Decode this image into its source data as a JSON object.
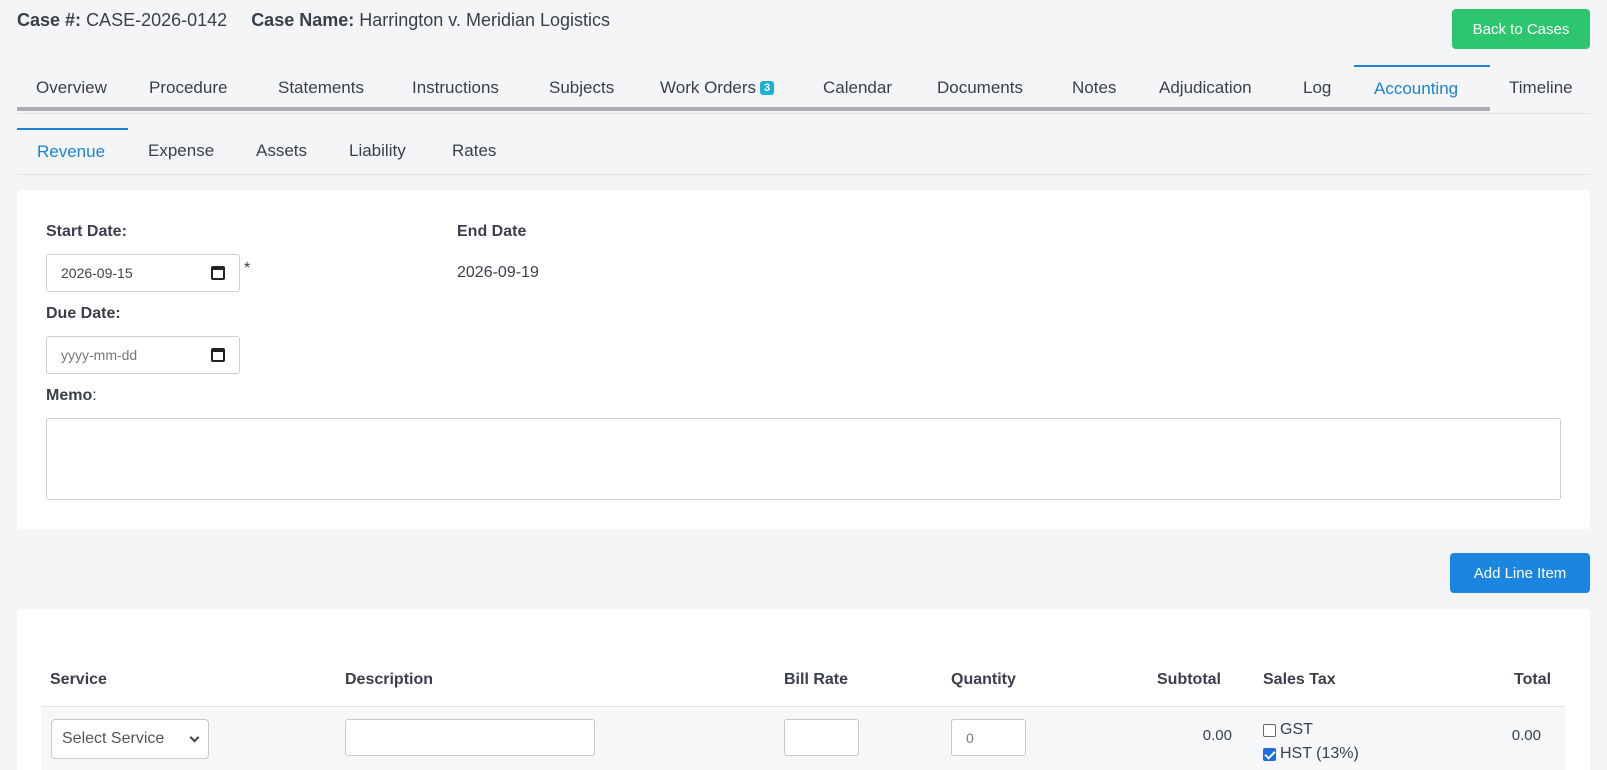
{
  "header": {
    "case_no_label": "Case #:",
    "case_no": "CASE-2026-0142",
    "case_name_label": "Case Name:",
    "case_name": "Harrington v. Meridian Logistics",
    "back_button": "Back to Cases"
  },
  "tabs": [
    {
      "label": "Overview"
    },
    {
      "label": "Procedure"
    },
    {
      "label": "Statements"
    },
    {
      "label": "Instructions"
    },
    {
      "label": "Subjects"
    },
    {
      "label": "Work Orders",
      "badge": "3"
    },
    {
      "label": "Calendar"
    },
    {
      "label": "Documents"
    },
    {
      "label": "Notes"
    },
    {
      "label": "Adjudication"
    },
    {
      "label": "Log"
    },
    {
      "label": "Accounting",
      "active": true
    },
    {
      "label": "Timeline"
    }
  ],
  "subtabs": [
    {
      "label": "Revenue",
      "active": true
    },
    {
      "label": "Expense"
    },
    {
      "label": "Assets"
    },
    {
      "label": "Liability"
    },
    {
      "label": "Rates"
    }
  ],
  "form": {
    "start_date_label": "Start Date:",
    "start_date_value": "2026-09-15",
    "required_mark": "*",
    "end_date_label": "End Date",
    "end_date_value": "2026-09-19",
    "due_date_label": "Due Date:",
    "due_date_placeholder": "yyyy-mm-dd",
    "memo_label": "Memo",
    "memo_colon": ":",
    "memo_value": ""
  },
  "add_line_item": "Add Line Item",
  "table": {
    "headers": {
      "service": "Service",
      "description": "Description",
      "bill_rate": "Bill Rate",
      "quantity": "Quantity",
      "subtotal": "Subtotal",
      "sales_tax": "Sales Tax",
      "total": "Total"
    },
    "rows": [
      {
        "service": "Select Service",
        "description": "",
        "bill_rate": "",
        "quantity": "0",
        "subtotal": "0.00",
        "taxes": [
          {
            "label": "GST",
            "checked": false
          },
          {
            "label": "HST (13%)",
            "checked": true
          }
        ],
        "total": "0.00"
      }
    ]
  },
  "colors": {
    "accent": "#1b82d6",
    "success": "#2ec56f",
    "primary_button": "#1b86e0"
  }
}
